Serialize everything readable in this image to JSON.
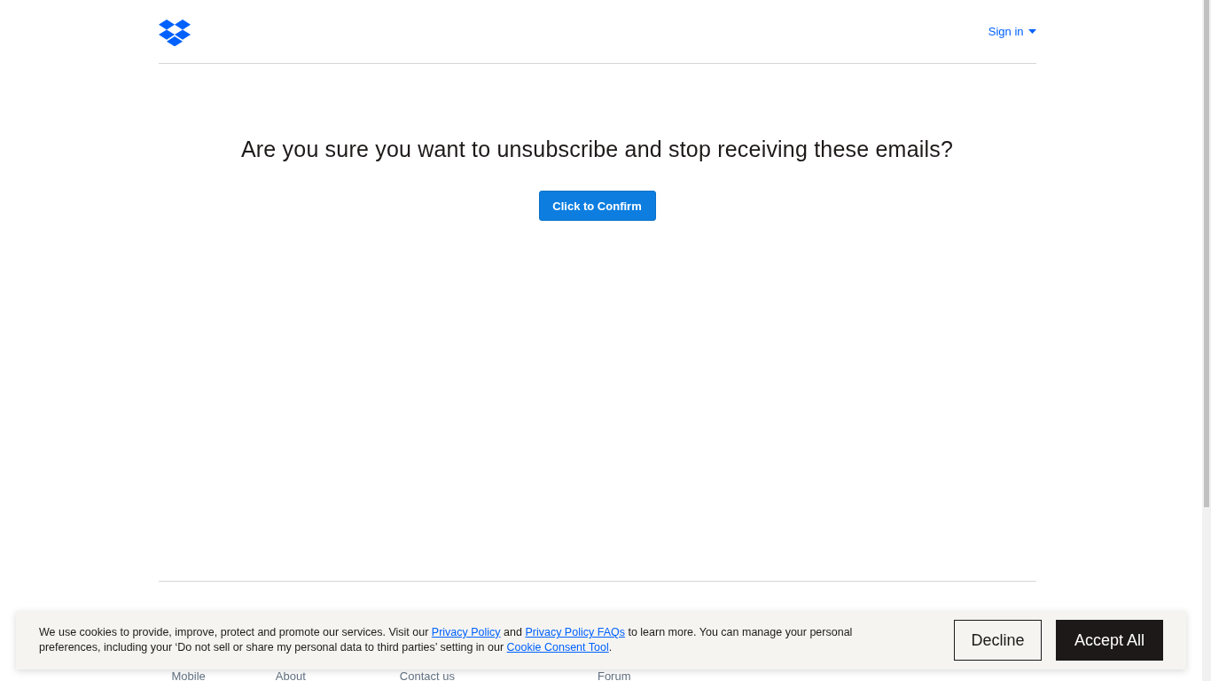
{
  "header": {
    "sign_in": "Sign in"
  },
  "heading": "Are you sure you want to unsubscribe and stop receiving these emails?",
  "confirm_button": "Click to Confirm",
  "footer_links": [
    "Mobile",
    "About",
    "Contact us",
    "Forum"
  ],
  "cookie_banner": {
    "text_parts": [
      "We use cookies to provide, improve, protect and promote our services. Visit our ",
      "Privacy Policy",
      " and ",
      "Privacy Policy FAQs",
      " to learn more. You can manage your personal preferences, including your ‘Do not sell or share my personal data to third parties’ setting in our ",
      "Cookie Consent Tool",
      "."
    ],
    "buttons": [
      {
        "label": "Decline",
        "kind": "secondary"
      },
      {
        "label": "Accept All",
        "kind": "primary"
      }
    ]
  }
}
